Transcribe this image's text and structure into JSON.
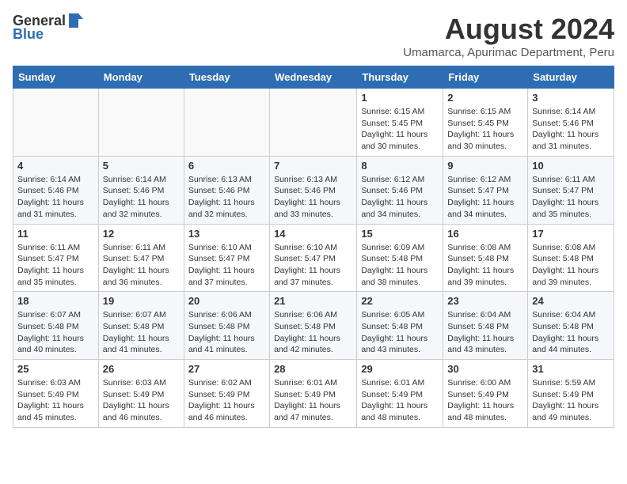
{
  "logo": {
    "general": "General",
    "blue": "Blue"
  },
  "header": {
    "title": "August 2024",
    "subtitle": "Umamarca, Apurimac Department, Peru"
  },
  "weekdays": [
    "Sunday",
    "Monday",
    "Tuesday",
    "Wednesday",
    "Thursday",
    "Friday",
    "Saturday"
  ],
  "weeks": [
    [
      {
        "day": "",
        "detail": ""
      },
      {
        "day": "",
        "detail": ""
      },
      {
        "day": "",
        "detail": ""
      },
      {
        "day": "",
        "detail": ""
      },
      {
        "day": "1",
        "detail": "Sunrise: 6:15 AM\nSunset: 5:45 PM\nDaylight: 11 hours\nand 30 minutes."
      },
      {
        "day": "2",
        "detail": "Sunrise: 6:15 AM\nSunset: 5:45 PM\nDaylight: 11 hours\nand 30 minutes."
      },
      {
        "day": "3",
        "detail": "Sunrise: 6:14 AM\nSunset: 5:46 PM\nDaylight: 11 hours\nand 31 minutes."
      }
    ],
    [
      {
        "day": "4",
        "detail": "Sunrise: 6:14 AM\nSunset: 5:46 PM\nDaylight: 11 hours\nand 31 minutes."
      },
      {
        "day": "5",
        "detail": "Sunrise: 6:14 AM\nSunset: 5:46 PM\nDaylight: 11 hours\nand 32 minutes."
      },
      {
        "day": "6",
        "detail": "Sunrise: 6:13 AM\nSunset: 5:46 PM\nDaylight: 11 hours\nand 32 minutes."
      },
      {
        "day": "7",
        "detail": "Sunrise: 6:13 AM\nSunset: 5:46 PM\nDaylight: 11 hours\nand 33 minutes."
      },
      {
        "day": "8",
        "detail": "Sunrise: 6:12 AM\nSunset: 5:46 PM\nDaylight: 11 hours\nand 34 minutes."
      },
      {
        "day": "9",
        "detail": "Sunrise: 6:12 AM\nSunset: 5:47 PM\nDaylight: 11 hours\nand 34 minutes."
      },
      {
        "day": "10",
        "detail": "Sunrise: 6:11 AM\nSunset: 5:47 PM\nDaylight: 11 hours\nand 35 minutes."
      }
    ],
    [
      {
        "day": "11",
        "detail": "Sunrise: 6:11 AM\nSunset: 5:47 PM\nDaylight: 11 hours\nand 35 minutes."
      },
      {
        "day": "12",
        "detail": "Sunrise: 6:11 AM\nSunset: 5:47 PM\nDaylight: 11 hours\nand 36 minutes."
      },
      {
        "day": "13",
        "detail": "Sunrise: 6:10 AM\nSunset: 5:47 PM\nDaylight: 11 hours\nand 37 minutes."
      },
      {
        "day": "14",
        "detail": "Sunrise: 6:10 AM\nSunset: 5:47 PM\nDaylight: 11 hours\nand 37 minutes."
      },
      {
        "day": "15",
        "detail": "Sunrise: 6:09 AM\nSunset: 5:48 PM\nDaylight: 11 hours\nand 38 minutes."
      },
      {
        "day": "16",
        "detail": "Sunrise: 6:08 AM\nSunset: 5:48 PM\nDaylight: 11 hours\nand 39 minutes."
      },
      {
        "day": "17",
        "detail": "Sunrise: 6:08 AM\nSunset: 5:48 PM\nDaylight: 11 hours\nand 39 minutes."
      }
    ],
    [
      {
        "day": "18",
        "detail": "Sunrise: 6:07 AM\nSunset: 5:48 PM\nDaylight: 11 hours\nand 40 minutes."
      },
      {
        "day": "19",
        "detail": "Sunrise: 6:07 AM\nSunset: 5:48 PM\nDaylight: 11 hours\nand 41 minutes."
      },
      {
        "day": "20",
        "detail": "Sunrise: 6:06 AM\nSunset: 5:48 PM\nDaylight: 11 hours\nand 41 minutes."
      },
      {
        "day": "21",
        "detail": "Sunrise: 6:06 AM\nSunset: 5:48 PM\nDaylight: 11 hours\nand 42 minutes."
      },
      {
        "day": "22",
        "detail": "Sunrise: 6:05 AM\nSunset: 5:48 PM\nDaylight: 11 hours\nand 43 minutes."
      },
      {
        "day": "23",
        "detail": "Sunrise: 6:04 AM\nSunset: 5:48 PM\nDaylight: 11 hours\nand 43 minutes."
      },
      {
        "day": "24",
        "detail": "Sunrise: 6:04 AM\nSunset: 5:48 PM\nDaylight: 11 hours\nand 44 minutes."
      }
    ],
    [
      {
        "day": "25",
        "detail": "Sunrise: 6:03 AM\nSunset: 5:49 PM\nDaylight: 11 hours\nand 45 minutes."
      },
      {
        "day": "26",
        "detail": "Sunrise: 6:03 AM\nSunset: 5:49 PM\nDaylight: 11 hours\nand 46 minutes."
      },
      {
        "day": "27",
        "detail": "Sunrise: 6:02 AM\nSunset: 5:49 PM\nDaylight: 11 hours\nand 46 minutes."
      },
      {
        "day": "28",
        "detail": "Sunrise: 6:01 AM\nSunset: 5:49 PM\nDaylight: 11 hours\nand 47 minutes."
      },
      {
        "day": "29",
        "detail": "Sunrise: 6:01 AM\nSunset: 5:49 PM\nDaylight: 11 hours\nand 48 minutes."
      },
      {
        "day": "30",
        "detail": "Sunrise: 6:00 AM\nSunset: 5:49 PM\nDaylight: 11 hours\nand 48 minutes."
      },
      {
        "day": "31",
        "detail": "Sunrise: 5:59 AM\nSunset: 5:49 PM\nDaylight: 11 hours\nand 49 minutes."
      }
    ]
  ]
}
